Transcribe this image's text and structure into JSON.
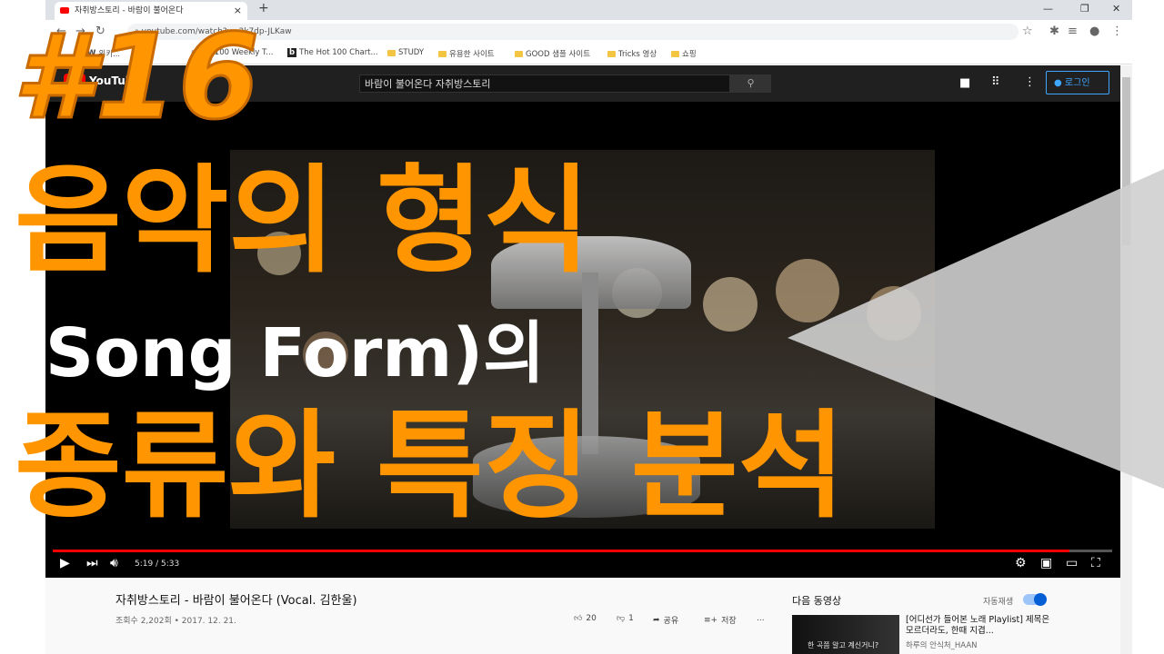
{
  "browser": {
    "tab_title": "자취방스토리 - 바람이 불어온다",
    "tab_close": "×",
    "new_tab": "+",
    "url": "youtube.com/watch?v=3k7dp-JLKaw",
    "bookmarks": [
      {
        "label": "위키...",
        "icon": "wiki-icon"
      },
      {
        "label": "Top 100 Weekly T...",
        "icon": "page-icon"
      },
      {
        "label": "The Hot 100 Chart...",
        "icon": "billboard-icon"
      },
      {
        "label": "STUDY",
        "icon": "folder-icon"
      },
      {
        "label": "유용한 사이트",
        "icon": "folder-icon"
      },
      {
        "label": "GOOD 샘플 사이트",
        "icon": "folder-icon"
      },
      {
        "label": "Tricks 영상",
        "icon": "folder-icon"
      },
      {
        "label": "쇼핑",
        "icon": "folder-icon"
      }
    ]
  },
  "youtube": {
    "logo_text": "YouTube",
    "search_value": "바람이 불어온다 자취방스토리",
    "login_label": "로그인",
    "player": {
      "time": "5:19 / 5:33",
      "progress_fraction": 0.96
    },
    "video": {
      "title": "자취방스토리 - 바람이 불어온다 (Vocal. 김한울)",
      "views": "조회수 2,202회 • 2017. 12. 21.",
      "likes": "20",
      "dislikes": "1",
      "share_label": "공유",
      "save_label": "저장",
      "more_label": "..."
    },
    "sidebar": {
      "heading": "다음 동영상",
      "autoplay_label": "자동재생",
      "next_title": "[어디선가 들어본 노래 Playlist] 제목은 모르더라도, 한때 지겹...",
      "next_channel": "하루의 안식처_HAAN",
      "thumb_text": "한 곡쯤 알고 계신거니?"
    }
  },
  "overlay": {
    "number": "#16",
    "line1": "음악의 형식",
    "line2": "(Song Form)의",
    "line3": "종류와 특징 분석",
    "accent_color": "#ff9500"
  }
}
